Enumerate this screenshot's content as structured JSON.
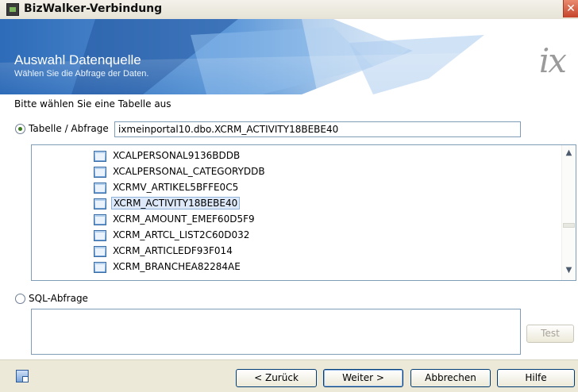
{
  "window": {
    "title": "BizWalker-Verbindung",
    "close_glyph": "✕"
  },
  "header": {
    "title": "Auswahl Datenquelle",
    "subtitle": "Wählen Sie die Abfrage der Daten.",
    "logo_text": "ix"
  },
  "content": {
    "instruction": "Bitte wählen Sie eine Tabelle aus",
    "table_option": {
      "label": "Tabelle / Abfrage",
      "value": "ixmeinportal10.dbo.XCRM_ACTIVITY18BEBE40",
      "checked": true
    },
    "table_list": {
      "items": [
        {
          "label": "XCALPERSONAL9136BDDB",
          "selected": false
        },
        {
          "label": "XCALPERSONAL_CATEGORYDDB",
          "selected": false
        },
        {
          "label": "XCRMV_ARTIKEL5BFFE0C5",
          "selected": false
        },
        {
          "label": "XCRM_ACTIVITY18BEBE40",
          "selected": true
        },
        {
          "label": "XCRM_AMOUNT_EMEF60D5F9",
          "selected": false
        },
        {
          "label": "XCRM_ARTCL_LIST2C60D032",
          "selected": false
        },
        {
          "label": "XCRM_ARTICLEDF93F014",
          "selected": false
        },
        {
          "label": "XCRM_BRANCHEA82284AE",
          "selected": false
        }
      ]
    },
    "sql_option": {
      "label": "SQL-Abfrage",
      "checked": false,
      "query": ""
    },
    "test_button": "Test"
  },
  "footer": {
    "back_button": "< Zurück",
    "next_button": "Weiter >",
    "cancel_button": "Abbrechen",
    "help_button": "Hilfe"
  },
  "colors": {
    "accent_green": "#3a7b1c",
    "banner_blue": "#3b78c4",
    "selection": "#dde9f8"
  }
}
